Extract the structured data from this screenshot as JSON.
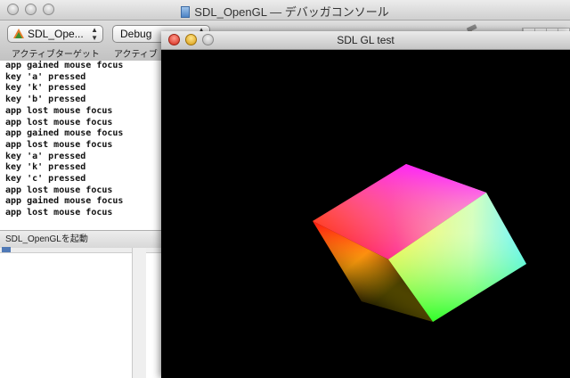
{
  "debugger_window": {
    "title": "SDL_OpenGL — デバッガコンソール",
    "toolbar": {
      "target_popup": "SDL_Ope...",
      "config_popup": "Debug",
      "caption_active_target": "アクティブターゲット",
      "caption_active_config": "アクティブ"
    },
    "console_lines": [
      "app gained mouse focus",
      "key 'a' pressed",
      "key 'k' pressed",
      "key 'b' pressed",
      "app lost mouse focus",
      "app lost mouse focus",
      "app gained mouse focus",
      "app lost mouse focus",
      "key 'a' pressed",
      "key 'k' pressed",
      "key 'c' pressed",
      "app lost mouse focus",
      "app gained mouse focus",
      "app lost mouse focus"
    ],
    "status_text": "SDL_OpenGLを起動"
  },
  "sdl_window": {
    "title": "SDL GL test"
  },
  "colors": {
    "background_black": "#000000",
    "stop_red": "#e2201b",
    "go_green": "#3fcc2e"
  }
}
